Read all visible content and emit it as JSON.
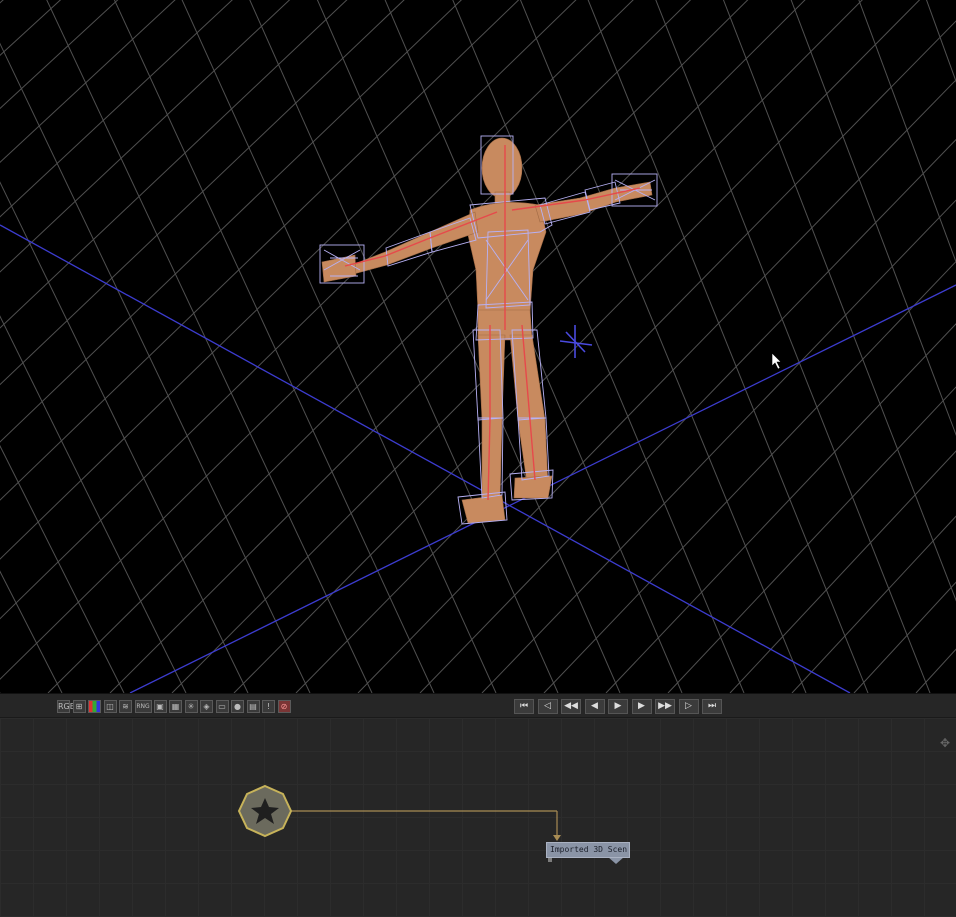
{
  "viewport": {
    "grid_color": "#4e4e4e",
    "axis_color": "#3a3acc",
    "figure_skin": "#c98a5e",
    "wire_color": "#b9b3f2",
    "bone_color": "#e04a4a"
  },
  "toolbar": {
    "view_icons": [
      {
        "name": "lut-icon",
        "glyph": "RGB"
      },
      {
        "name": "grid-icon",
        "glyph": "⊞"
      },
      {
        "name": "color-icon",
        "glyph": ""
      },
      {
        "name": "cube-icon",
        "glyph": "◫"
      },
      {
        "name": "layers-icon",
        "glyph": "≋"
      },
      {
        "name": "rng-icon",
        "glyph": "RNG"
      },
      {
        "name": "frame-icon",
        "glyph": "▣"
      },
      {
        "name": "grid-3d-icon",
        "glyph": "▦"
      },
      {
        "name": "light-icon",
        "glyph": "✳"
      },
      {
        "name": "shape-icon",
        "glyph": "◈"
      },
      {
        "name": "camera-icon",
        "glyph": "▭"
      },
      {
        "name": "sphere-icon",
        "glyph": "●"
      },
      {
        "name": "display-icon",
        "glyph": "▤"
      },
      {
        "name": "info-icon",
        "glyph": "!"
      },
      {
        "name": "stop-icon",
        "glyph": "⊘"
      }
    ],
    "playback": [
      {
        "name": "go-to-start-icon",
        "glyph": "⏮"
      },
      {
        "name": "prev-key-icon",
        "glyph": "◁"
      },
      {
        "name": "rewind-icon",
        "glyph": "◀◀"
      },
      {
        "name": "step-back-icon",
        "glyph": "◀"
      },
      {
        "name": "play-icon",
        "glyph": "▶"
      },
      {
        "name": "step-forward-icon",
        "glyph": "▶"
      },
      {
        "name": "fast-forward-icon",
        "glyph": "▶▶"
      },
      {
        "name": "next-key-icon",
        "glyph": "▷"
      },
      {
        "name": "go-to-end-icon",
        "glyph": "⏭"
      }
    ]
  },
  "flow": {
    "node_label": "Imported 3D Scen...",
    "nav_glyph": "✥"
  }
}
